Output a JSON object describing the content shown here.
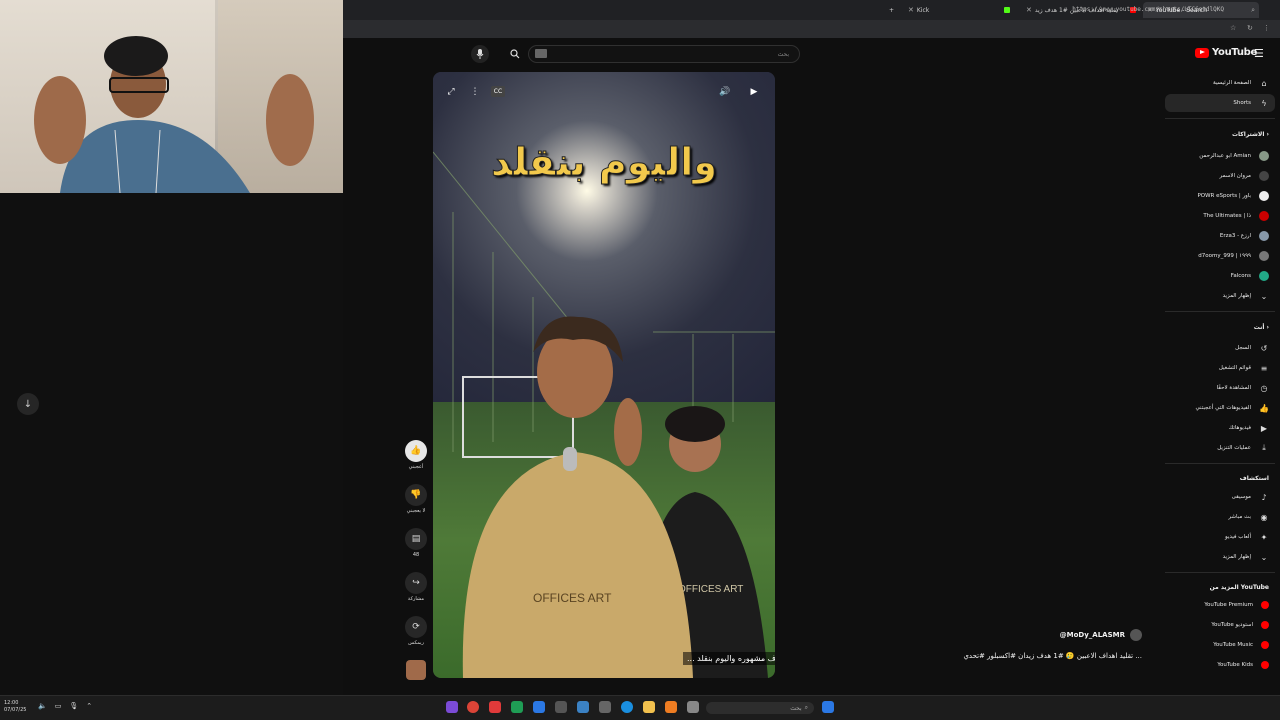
{
  "browser": {
    "tabs": [
      {
        "label": "Kick",
        "color": "#53fc18"
      },
      {
        "label": "تقليد اهداف الاعبين #1 هدف زيد",
        "color": "#ff0000"
      },
      {
        "label": "YouTube - Search",
        "color": "#ff0000"
      }
    ],
    "new_tab": "+",
    "url": "https://www.youtube.com/shorts/LTC6atdlQKQ"
  },
  "search": {
    "placeholder": "بحث"
  },
  "video": {
    "caption": "واليوم بنقلد",
    "subtitle": "... ف مشهوره واليوم بنقلد",
    "jersey_text": "OFFICES ART"
  },
  "actions": {
    "like": "أعجبني",
    "dislike": "لا يعجبني",
    "comments": "48",
    "share": "مشاركة",
    "remix": "ريمكس"
  },
  "channel": {
    "handle": "@MoDy_ALASMR",
    "title": "تقليد اهداف الاعبين 🥲 #1 هدف زيدان #اكسبلور #تحدي ..."
  },
  "sidebar": {
    "logo": "YouTube",
    "nav": [
      {
        "label": "الصفحة الرئيسية",
        "icon": "⌂"
      },
      {
        "label": "Shorts",
        "icon": "ϟ"
      }
    ],
    "subscriptions_title": "الاشتراكات",
    "subscriptions": [
      {
        "label": "ابو عبدالرحمن Amian",
        "color": "#889988"
      },
      {
        "label": "مروان الاسمر",
        "color": "#444444"
      },
      {
        "label": "POWR eSports | باور",
        "color": "#eeeeee"
      },
      {
        "label": "The Ultimates | ذا",
        "color": "#cc0000"
      },
      {
        "label": "Erza3 - ارزع",
        "color": "#8899aa"
      },
      {
        "label": "d7oomy_999 | ١٩٩٩",
        "color": "#777777"
      },
      {
        "label": "Falcons",
        "color": "#22aa88"
      }
    ],
    "show_more": "إظهار المزيد",
    "you_title": "أنت",
    "you_items": [
      {
        "label": "السجل",
        "icon": "↺"
      },
      {
        "label": "قوائم التشغيل",
        "icon": "≡"
      },
      {
        "label": "المشاهدة لاحقًا",
        "icon": "◷"
      },
      {
        "label": "الفيديوهات التي أعجبتني",
        "icon": "👍"
      },
      {
        "label": "فيديوهاتك",
        "icon": "▶"
      },
      {
        "label": "عمليات التنزيل",
        "icon": "⤓"
      }
    ],
    "explore_title": "استكشاف",
    "explore_items": [
      {
        "label": "موسيقى",
        "icon": "♪"
      },
      {
        "label": "بث مباشر",
        "icon": "◉"
      },
      {
        "label": "ألعاب فيديو",
        "icon": "✦"
      },
      {
        "label": "إظهار المزيد",
        "icon": "⌄"
      }
    ],
    "more_title": "المزيد من YouTube",
    "more_items": [
      {
        "label": "YouTube Premium"
      },
      {
        "label": "YouTube استوديو"
      },
      {
        "label": "YouTube Music"
      },
      {
        "label": "YouTube Kids"
      }
    ]
  },
  "taskbar": {
    "search": "بحث",
    "clock_time": "12:00",
    "clock_date": "07/07/25"
  }
}
